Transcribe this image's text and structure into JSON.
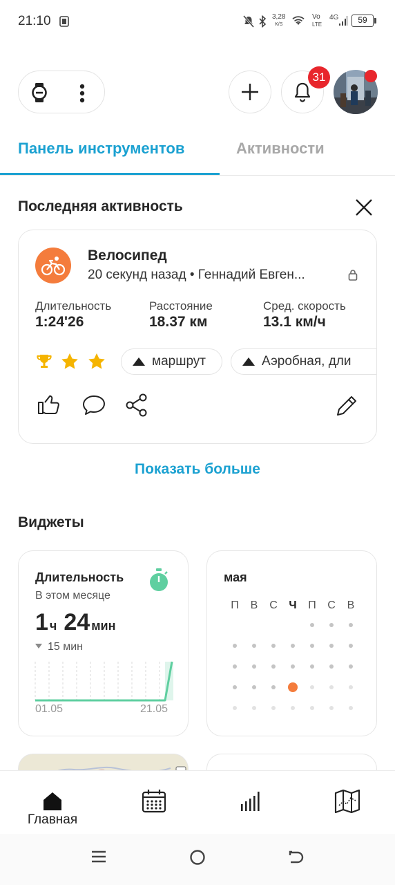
{
  "status_bar": {
    "time": "21:10",
    "network_speed_top": "3,28",
    "network_speed_bottom": "K/S",
    "volte_top": "Vo",
    "volte_bottom": "LTE",
    "network_type": "4G",
    "battery": "59"
  },
  "header": {
    "notifications_count": "31"
  },
  "tabs": [
    {
      "label": "Панель инструментов",
      "active": true
    },
    {
      "label": "Активности",
      "active": false
    }
  ],
  "last_activity": {
    "section_title": "Последняя активность",
    "sport": "Велосипед",
    "subtitle": "20 секунд назад • Геннадий Евген...",
    "stats": [
      {
        "label": "Длительность",
        "value": "1:24'26"
      },
      {
        "label": "Расстояние",
        "value": "18.37 км"
      },
      {
        "label": "Сред. скорость",
        "value": "13.1 км/ч"
      }
    ],
    "achievements": [
      "trophy-icon",
      "star-icon",
      "star-icon"
    ],
    "chips": [
      "маршрут",
      "Аэробная, дли"
    ]
  },
  "show_more": "Показать больше",
  "widgets": {
    "section_title": "Виджеты",
    "duration": {
      "title": "Длительность",
      "subtitle": "В этом месяце",
      "hours": "1",
      "hours_unit": "ч",
      "minutes": "24",
      "minutes_unit": "мин",
      "delta": "15 мин",
      "axis_start": "01.05",
      "axis_end": "21.05"
    },
    "calendar": {
      "month": "мая",
      "weekdays": [
        "П",
        "В",
        "С",
        "Ч",
        "П",
        "С",
        "В"
      ],
      "today_index": 3
    }
  },
  "bottom_nav": {
    "items": [
      {
        "icon": "home-icon",
        "label": "Главная"
      },
      {
        "icon": "calendar-icon",
        "label": ""
      },
      {
        "icon": "stats-icon",
        "label": ""
      },
      {
        "icon": "map-icon",
        "label": ""
      }
    ]
  },
  "colors": {
    "accent": "#1ba1d1",
    "sport": "#f47c3c",
    "chart": "#5fcfa0",
    "badge": "#e8262c",
    "star": "#f5b400"
  }
}
